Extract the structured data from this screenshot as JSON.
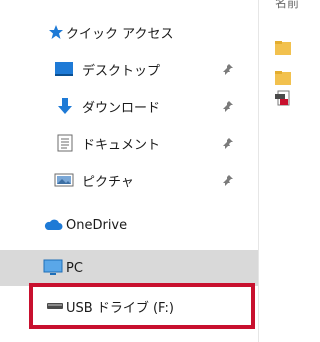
{
  "nav": {
    "quick_access": "クイック アクセス",
    "desktop": "デスクトップ",
    "downloads": "ダウンロード",
    "documents": "ドキュメント",
    "pictures": "ピクチャ",
    "onedrive": "OneDrive",
    "pc": "PC",
    "usb_drive": "USB ドライブ (F:)"
  },
  "content": {
    "header_clipped": "名前"
  },
  "icons": {
    "quick_access": "star-icon",
    "desktop": "desktop-icon",
    "downloads": "download-arrow-icon",
    "documents": "document-icon",
    "pictures": "pictures-icon",
    "onedrive": "cloud-icon",
    "pc": "computer-icon",
    "usb_drive": "usb-drive-icon",
    "pin": "pin-icon"
  },
  "colors": {
    "selected_row": "#d9d9d9",
    "highlight": "#c8102e",
    "accent": "#1e7ad6",
    "folder": "#f2c14e"
  }
}
